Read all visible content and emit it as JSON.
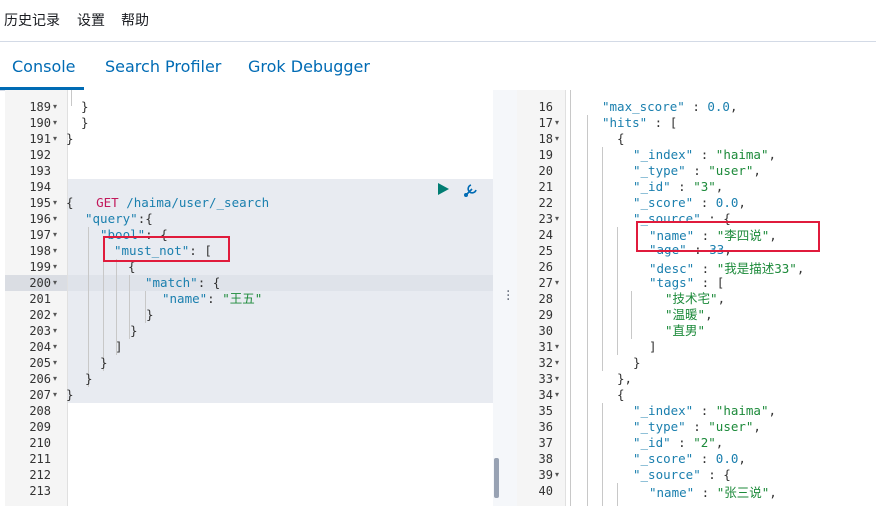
{
  "top_menu": {
    "history": "历史记录",
    "settings": "设置",
    "help": "帮助"
  },
  "tabs": [
    {
      "label": "Console"
    },
    {
      "label": "Search Profiler"
    },
    {
      "label": "Grok Debugger"
    }
  ],
  "left_editor": {
    "lines": [
      {
        "n": "189",
        "text": "  }",
        "fold": true
      },
      {
        "n": "190",
        "text": "  }",
        "fold": true
      },
      {
        "n": "191",
        "text": "}",
        "fold": true
      },
      {
        "n": "192",
        "text": "",
        "fold": false
      },
      {
        "n": "193",
        "text": "",
        "fold": false
      },
      {
        "n": "194",
        "text": "",
        "fold": false
      },
      {
        "n": "195",
        "text": "{",
        "fold": true
      },
      {
        "n": "196",
        "text": "",
        "fold": true
      },
      {
        "n": "197",
        "text": "",
        "fold": true
      },
      {
        "n": "198",
        "text": "",
        "fold": true
      },
      {
        "n": "199",
        "text": "",
        "fold": true
      },
      {
        "n": "200",
        "text": "",
        "fold": true
      },
      {
        "n": "201",
        "text": "",
        "fold": false
      },
      {
        "n": "202",
        "text": "",
        "fold": true
      },
      {
        "n": "203",
        "text": "",
        "fold": true
      },
      {
        "n": "204",
        "text": "",
        "fold": true
      },
      {
        "n": "205",
        "text": "",
        "fold": true
      },
      {
        "n": "206",
        "text": "",
        "fold": true
      },
      {
        "n": "207",
        "text": "}",
        "fold": true
      },
      {
        "n": "208",
        "text": "",
        "fold": false
      },
      {
        "n": "209",
        "text": "",
        "fold": false
      },
      {
        "n": "210",
        "text": "",
        "fold": false
      },
      {
        "n": "211",
        "text": "",
        "fold": false
      },
      {
        "n": "212",
        "text": "",
        "fold": false
      },
      {
        "n": "213",
        "text": "",
        "fold": false
      }
    ],
    "request_method": "GET",
    "request_path": " /haima/user/_search",
    "query_key": "\"query\"",
    "bool_key": "\"bool\"",
    "must_not_key": "\"must_not\"",
    "match_key": "\"match\"",
    "name_key": "\"name\"",
    "name_value": "\"王五\"",
    "run_icon": "play-icon",
    "settings_icon": "wrench-icon"
  },
  "right_editor": {
    "line_numbers": [
      "16",
      "17",
      "18",
      "19",
      "20",
      "21",
      "22",
      "23",
      "24",
      "25",
      "26",
      "27",
      "28",
      "29",
      "30",
      "31",
      "32",
      "33",
      "34",
      "35",
      "36",
      "37",
      "38",
      "39",
      "40"
    ],
    "max_score_key": "\"max_score\"",
    "max_score_val": "0.0",
    "hits_key": "\"hits\"",
    "index_key": "\"_index\"",
    "index_val": "\"haima\"",
    "type_key": "\"_type\"",
    "type_val": "\"user\"",
    "id_key": "\"_id\"",
    "id_val_1": "\"3\"",
    "id_val_2": "\"2\"",
    "score_key": "\"_score\"",
    "score_val": "0.0",
    "source_key": "\"_source\"",
    "name_key": "\"name\"",
    "name_val_1": "\"李四说\"",
    "name_val_2": "\"张三说\"",
    "age_key": "\"age\"",
    "age_val": "33",
    "desc_key": "\"desc\"",
    "desc_val": "\"我是描述33\"",
    "tags_key": "\"tags\"",
    "tag_1": "\"技术宅\"",
    "tag_2": "\"温暖\"",
    "tag_3": "\"直男\""
  },
  "colors": {
    "accent": "#006bb4",
    "highlight_box": "#e01b3c"
  }
}
